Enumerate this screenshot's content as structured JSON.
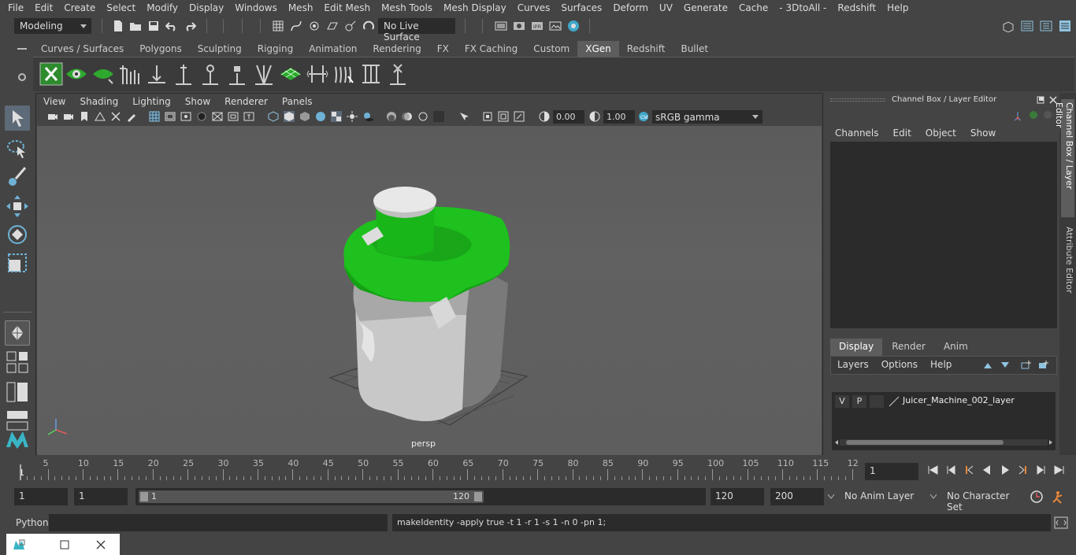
{
  "menubar": [
    "File",
    "Edit",
    "Create",
    "Select",
    "Modify",
    "Display",
    "Windows",
    "Mesh",
    "Edit Mesh",
    "Mesh Tools",
    "Mesh Display",
    "Curves",
    "Surfaces",
    "Deform",
    "UV",
    "Generate",
    "Cache",
    "- 3DtoAll -",
    "Redshift",
    "Help"
  ],
  "status": {
    "mode": "Modeling",
    "live_surface": "No Live Surface"
  },
  "shelf": {
    "tabs": [
      "Curves / Surfaces",
      "Polygons",
      "Sculpting",
      "Rigging",
      "Animation",
      "Rendering",
      "FX",
      "FX Caching",
      "Custom",
      "XGen",
      "Redshift",
      "Bullet"
    ],
    "active_tab": "XGen"
  },
  "viewport": {
    "menu": [
      "View",
      "Shading",
      "Lighting",
      "Show",
      "Renderer",
      "Panels"
    ],
    "exposure": "0.00",
    "gamma": "1.00",
    "colorspace": "sRGB gamma",
    "camera_label": "persp"
  },
  "channelbox": {
    "title": "Channel Box / Layer Editor",
    "menu": [
      "Channels",
      "Edit",
      "Object",
      "Show"
    ],
    "layer_tabs": [
      "Display",
      "Render",
      "Anim"
    ],
    "active_layer_tab": "Display",
    "layer_menu": [
      "Layers",
      "Options",
      "Help"
    ],
    "layer": {
      "v": "V",
      "p": "P",
      "name": "Juicer_Machine_002_layer"
    },
    "side_tabs": [
      "Channel Box / Layer Editor",
      "Attribute Editor"
    ]
  },
  "timeline": {
    "ticks": [
      "5",
      "10",
      "15",
      "20",
      "25",
      "30",
      "35",
      "40",
      "45",
      "50",
      "55",
      "60",
      "65",
      "70",
      "75",
      "80",
      "85",
      "90",
      "95",
      "100",
      "105",
      "110",
      "115",
      "12"
    ],
    "start_label": "1",
    "current_frame": "1"
  },
  "range": {
    "start": "1",
    "playback_start": "1",
    "slider_start": "1",
    "slider_end": "120",
    "playback_end": "120",
    "end": "200",
    "anim_layer": "No Anim Layer",
    "char_set": "No Character Set"
  },
  "cmdline": {
    "label": "Python",
    "result": "makeIdentity -apply true -t 1 -r 1 -s 1 -n 0 -pn 1;"
  }
}
